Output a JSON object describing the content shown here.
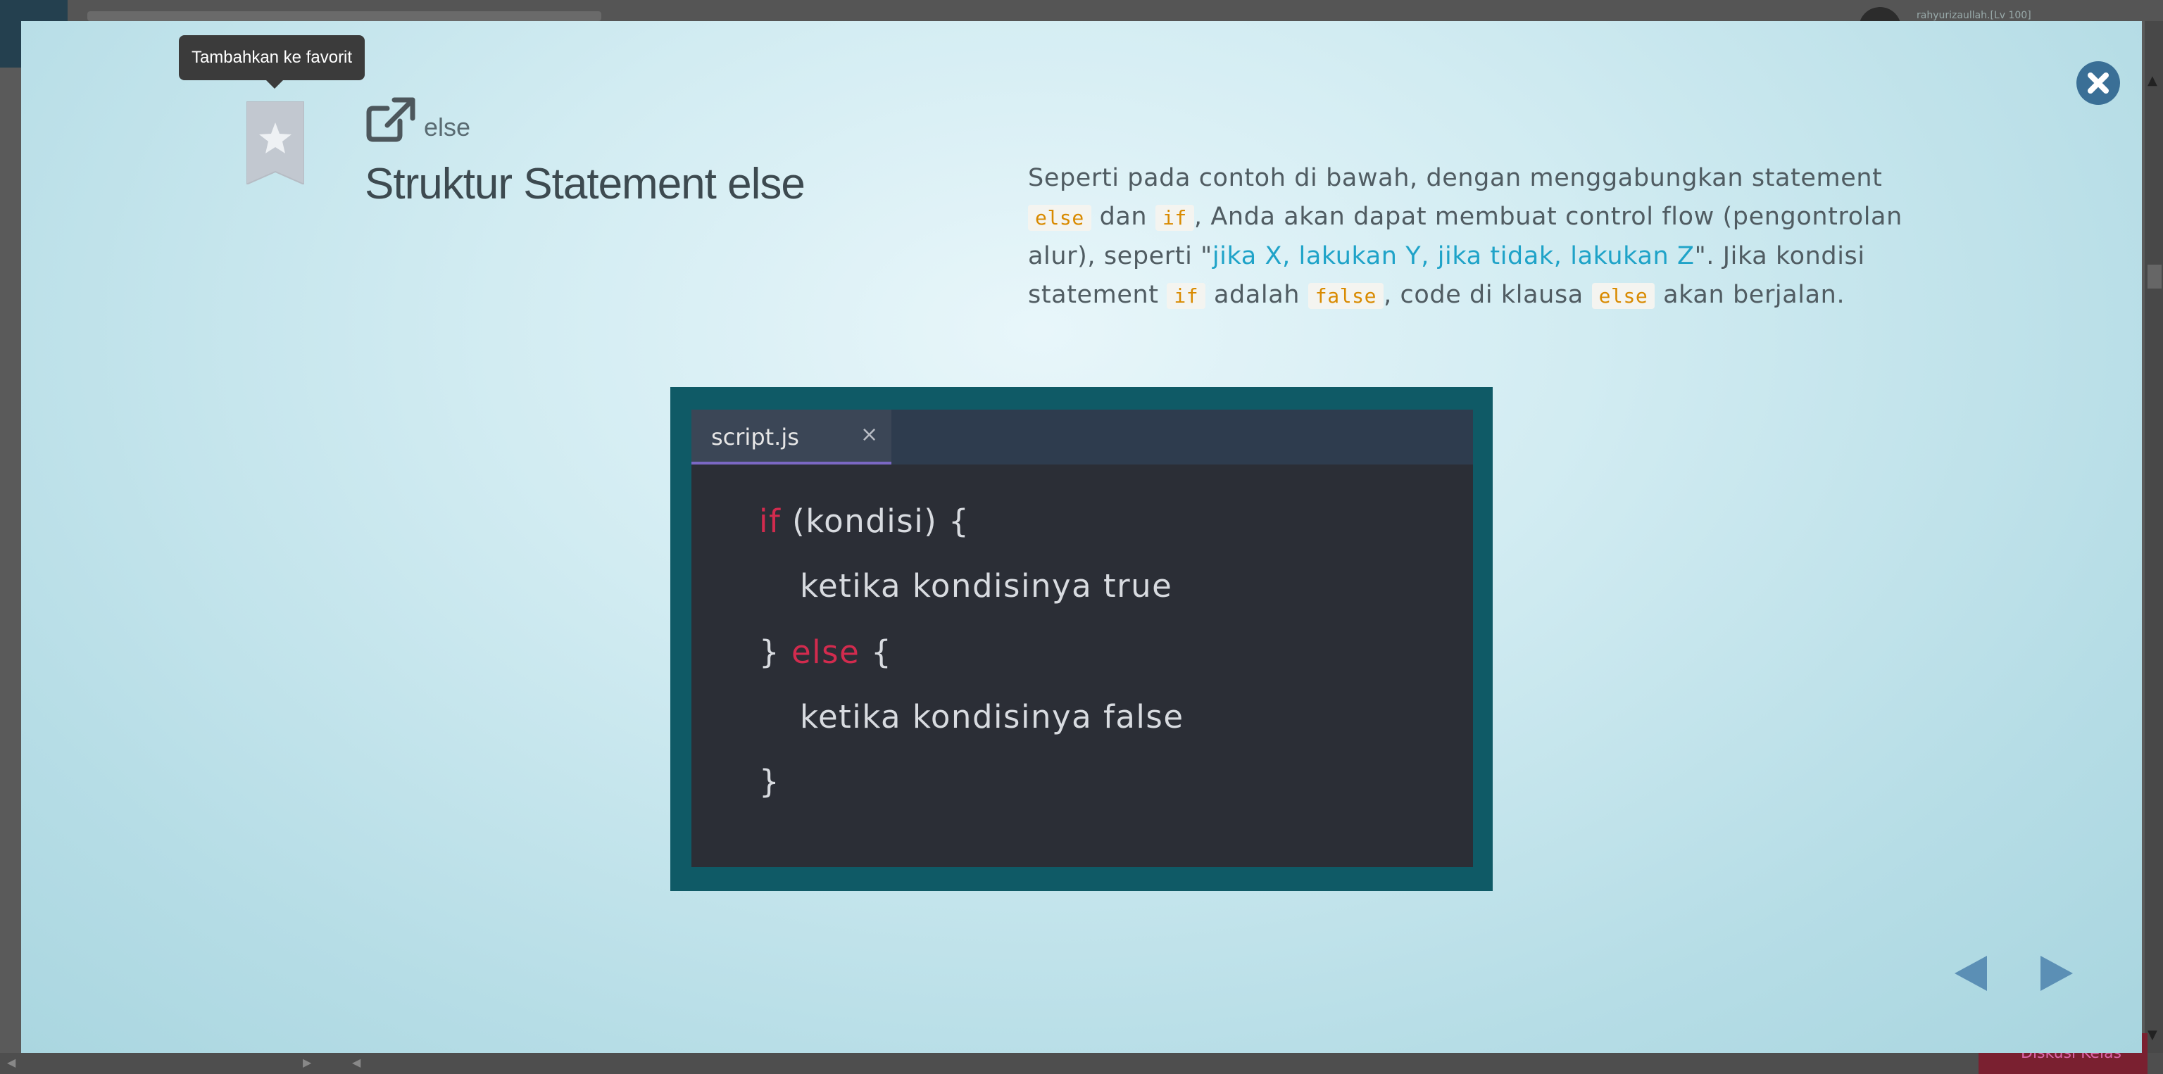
{
  "background": {
    "user_label": "rahyurizaullah.[Lv 100]",
    "discuss_label": "Diskusi Kelas"
  },
  "modal": {
    "tooltip": "Tambahkan ke favorit",
    "breadcrumb": "else",
    "title": "Struktur Statement else",
    "description": {
      "p1": "Seperti pada contoh di bawah, dengan menggabungkan statement ",
      "c1": "else",
      "p2": " dan ",
      "c2": "if",
      "p3": ", Anda akan dapat membuat control flow (pengontrolan alur), seperti \"",
      "highlight": "jika X, lakukan Y, jika tidak, lakukan Z",
      "p4": "\". Jika kondisi statement ",
      "c3": "if",
      "p5": " adalah ",
      "c4": "false",
      "p6": ", code di klausa ",
      "c5": "else",
      "p7": " akan berjalan."
    },
    "code": {
      "tab_name": "script.js",
      "tab_close": "×",
      "line1_kw": "if",
      "line1_rest": " (kondisi) {",
      "line2": "ketika kondisinya true",
      "line3_a": "} ",
      "line3_kw": "else",
      "line3_b": " {",
      "line4": "ketika kondisinya false",
      "line5": "}"
    }
  },
  "icons": {
    "bookmark": "star-bookmark-icon",
    "external": "external-link-icon",
    "close": "close-circle-icon",
    "prev": "triangle-left-icon",
    "next": "triangle-right-icon"
  },
  "colors": {
    "accent": "#3a6f96",
    "keyword": "#d22b4e",
    "inline_code": "#d98a00",
    "highlight": "#1fa3c8",
    "code_frame": "#0f5a66",
    "editor_bg": "#2b2e36"
  }
}
